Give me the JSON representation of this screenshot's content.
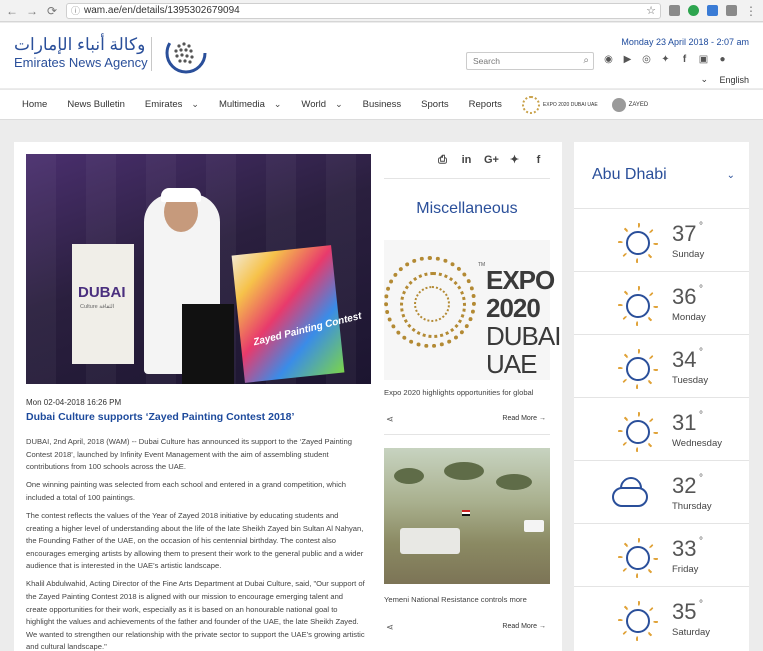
{
  "browser": {
    "back": "←",
    "forward": "→",
    "reload": "⟳",
    "url": "wam.ae/en/details/1395302679094"
  },
  "header": {
    "logo_ar": "وكالة أنباء الإمارات",
    "logo_en": "Emirates News Agency",
    "date": "Monday 23 April 2018 - 2:07 am",
    "search_placeholder": "Search",
    "language": "English",
    "social_icons": [
      "rss-icon",
      "youtube-icon",
      "instagram-icon",
      "twitter-icon",
      "facebook-icon",
      "android-icon",
      "apple-icon"
    ]
  },
  "menu": {
    "items": [
      {
        "label": "Home",
        "dropdown": false
      },
      {
        "label": "News Bulletin",
        "dropdown": false
      },
      {
        "label": "Emirates",
        "dropdown": true
      },
      {
        "label": "Multimedia",
        "dropdown": true
      },
      {
        "label": "World",
        "dropdown": true
      },
      {
        "label": "Business",
        "dropdown": false
      },
      {
        "label": "Sports",
        "dropdown": false
      },
      {
        "label": "Reports",
        "dropdown": false
      }
    ],
    "expo_badge": "EXPO 2020 DUBAI UAE",
    "zayed_badge": "ZAYED"
  },
  "article": {
    "hero_banner": "DUBAI",
    "hero_banner_sub": "Culture الثقافة",
    "hero_art_text": "Zayed Painting Contest",
    "date": "Mon 02-04-2018 16:26 PM",
    "title": "Dubai Culture supports ‘Zayed Painting Contest 2018’",
    "paragraphs": [
      "DUBAI, 2nd April, 2018 (WAM) -- Dubai Culture has announced its support to the ‘Zayed Painting Contest 2018’, launched by Infinity Event Management with the aim of assembling student contributions from 100 schools across the UAE.",
      "One winning painting was selected from each school and entered in a grand competition, which included a total of 100 paintings.",
      "The contest reflects the values of the Year of Zayed 2018 initiative by educating students and creating a higher level of understanding about the life of the late Sheikh Zayed bin Sultan Al Nahyan, the Founding Father of the UAE, on the occasion of his centennial birthday. The contest also encourages emerging artists by allowing them to present their work to the general public and a wider audience that is interested in the UAE’s artistic landscape.",
      "Khalil Abdulwahid, Acting Director of the Fine Arts Department at Dubai Culture, said, \"Our support of the Zayed Painting Contest 2018 is aligned with our mission to encourage emerging talent and create opportunities for their work, especially as it is based on an honourable national goal to highlight the values and achievements of the father and founder of the UAE, the late Sheikh Zayed. We wanted to strengthen our relationship with the private sector to support the UAE’s growing artistic and cultural landscape.\""
    ]
  },
  "share_icons": [
    "print-icon",
    "linkedin-icon",
    "googleplus-icon",
    "twitter-icon",
    "facebook-icon"
  ],
  "sidebar": {
    "title": "Miscellaneous",
    "cards": [
      {
        "image_text_1": "EXPO",
        "image_text_2": "2020",
        "image_text_3": "DUBAI",
        "image_text_4": "UAE",
        "tm": "TM",
        "caption": "Expo 2020 highlights opportunities for global",
        "read_more": "Read More →"
      },
      {
        "caption": "Yemeni National Resistance controls more",
        "read_more": "Read More →"
      }
    ]
  },
  "weather": {
    "city": "Abu Dhabi",
    "degree_symbol": "°",
    "days": [
      {
        "temp": "37",
        "day": "Sunday",
        "icon": "sun-icon"
      },
      {
        "temp": "36",
        "day": "Monday",
        "icon": "sun-icon"
      },
      {
        "temp": "34",
        "day": "Tuesday",
        "icon": "sun-icon"
      },
      {
        "temp": "31",
        "day": "Wednesday",
        "icon": "sun-icon"
      },
      {
        "temp": "32",
        "day": "Thursday",
        "icon": "cloud-sun-icon"
      },
      {
        "temp": "33",
        "day": "Friday",
        "icon": "sun-icon"
      },
      {
        "temp": "35",
        "day": "Saturday",
        "icon": "sun-icon"
      }
    ]
  }
}
